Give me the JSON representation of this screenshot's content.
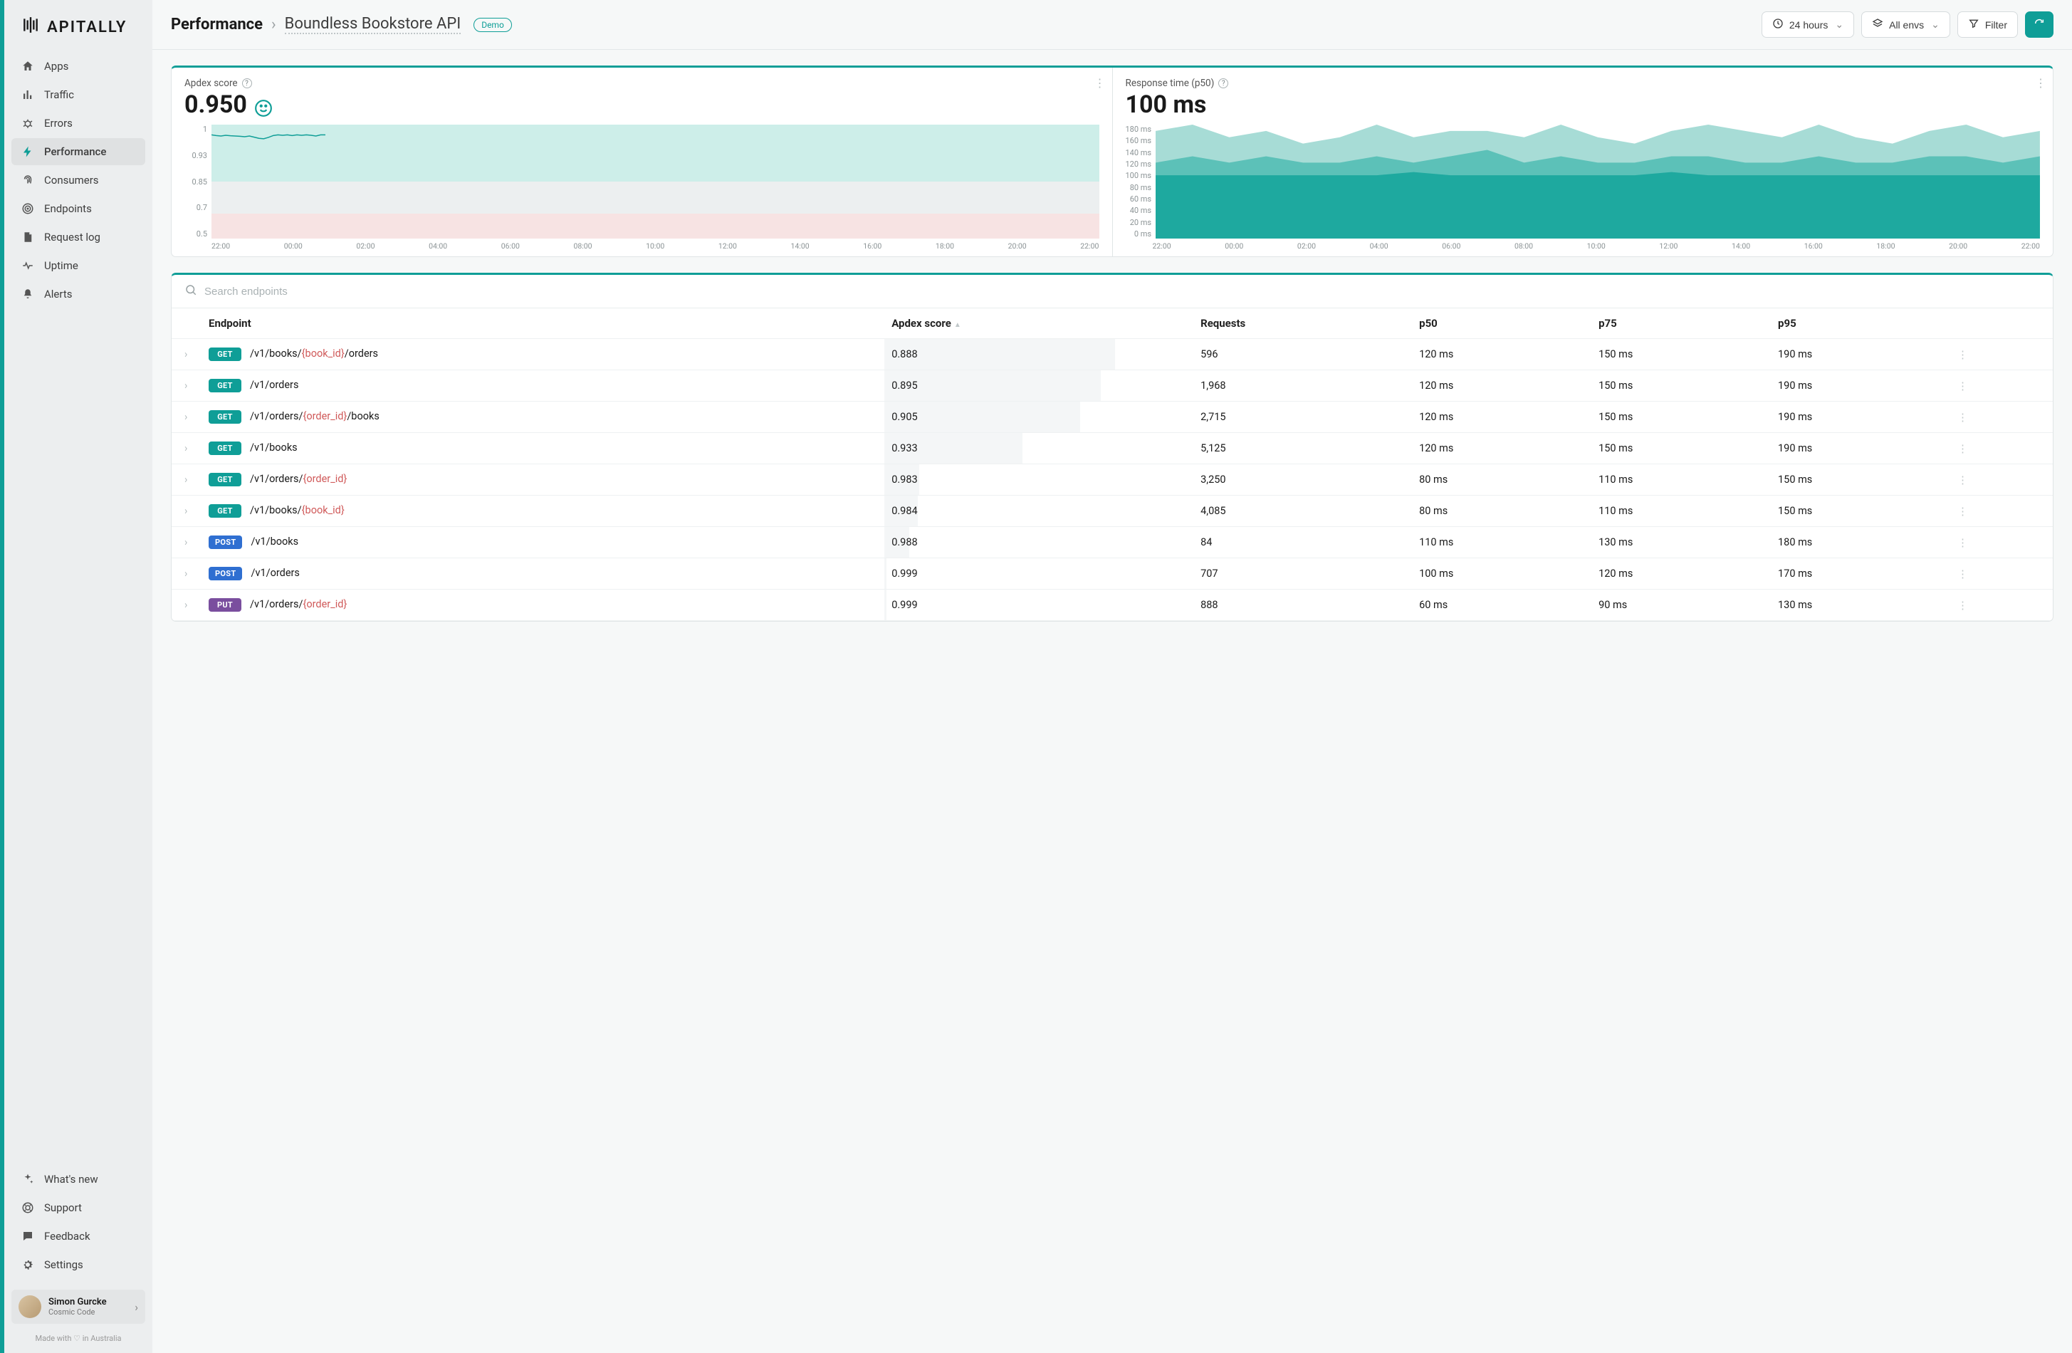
{
  "brand": "APITALLY",
  "sidebar": {
    "items": [
      {
        "label": "Apps",
        "icon": "home"
      },
      {
        "label": "Traffic",
        "icon": "bar"
      },
      {
        "label": "Errors",
        "icon": "bug"
      },
      {
        "label": "Performance",
        "icon": "bolt",
        "active": true
      },
      {
        "label": "Consumers",
        "icon": "fingerprint"
      },
      {
        "label": "Endpoints",
        "icon": "target"
      },
      {
        "label": "Request log",
        "icon": "doc"
      },
      {
        "label": "Uptime",
        "icon": "heart"
      },
      {
        "label": "Alerts",
        "icon": "bell"
      }
    ],
    "bottom": [
      {
        "label": "What's new",
        "icon": "sparkles"
      },
      {
        "label": "Support",
        "icon": "lifebuoy"
      },
      {
        "label": "Feedback",
        "icon": "chat"
      },
      {
        "label": "Settings",
        "icon": "gear"
      }
    ]
  },
  "user": {
    "name": "Simon Gurcke",
    "org": "Cosmic Code"
  },
  "footer": {
    "made": "Made with ♡ in Australia"
  },
  "header": {
    "crumb1": "Performance",
    "crumb2": "Boundless Bookstore API",
    "demo": "Demo",
    "time_range": "24 hours",
    "env": "All envs",
    "filter": "Filter"
  },
  "cards": {
    "apdex": {
      "title": "Apdex score",
      "value": "0.950"
    },
    "resp": {
      "title": "Response time (p50)",
      "value": "100 ms"
    }
  },
  "chart_data": [
    {
      "type": "area",
      "title": "Apdex score",
      "ylabel": "",
      "xlabel": "",
      "ylim": [
        0.5,
        1.0
      ],
      "y_ticks": [
        "1",
        "0.93",
        "0.85",
        "0.7",
        "0.5"
      ],
      "x_ticks": [
        "22:00",
        "00:00",
        "02:00",
        "04:00",
        "06:00",
        "08:00",
        "10:00",
        "12:00",
        "14:00",
        "16:00",
        "18:00",
        "20:00",
        "22:00"
      ],
      "bands": [
        {
          "from": 0.93,
          "to": 1.0,
          "color": "#cdeee9"
        },
        {
          "from": 0.85,
          "to": 0.93,
          "color": "#eceff0"
        },
        {
          "from": 0.5,
          "to": 0.85,
          "color": "#f7e3e3"
        }
      ],
      "series": [
        {
          "name": "apdex",
          "color": "#0f9e97",
          "values": [
            0.955,
            0.952,
            0.95,
            0.953,
            0.951,
            0.95,
            0.949,
            0.947,
            0.95,
            0.945,
            0.94,
            0.938,
            0.944,
            0.952,
            0.955,
            0.953,
            0.955,
            0.952,
            0.955,
            0.953,
            0.955,
            0.953,
            0.95,
            0.955,
            0.955
          ]
        }
      ]
    },
    {
      "type": "area",
      "title": "Response time",
      "ylabel": "ms",
      "xlabel": "",
      "ylim": [
        0,
        180
      ],
      "y_ticks": [
        "180 ms",
        "160 ms",
        "140 ms",
        "120 ms",
        "100 ms",
        "80 ms",
        "60 ms",
        "40 ms",
        "20 ms",
        "0 ms"
      ],
      "x_ticks": [
        "22:00",
        "00:00",
        "02:00",
        "04:00",
        "06:00",
        "08:00",
        "10:00",
        "12:00",
        "14:00",
        "16:00",
        "18:00",
        "20:00",
        "22:00"
      ],
      "series": [
        {
          "name": "p95",
          "color": "#a7dcd6",
          "values": [
            170,
            180,
            160,
            170,
            150,
            160,
            180,
            160,
            170,
            170,
            160,
            180,
            160,
            150,
            170,
            180,
            170,
            160,
            180,
            160,
            150,
            170,
            180,
            160,
            170
          ]
        },
        {
          "name": "p75",
          "color": "#5cc1b8",
          "values": [
            120,
            130,
            120,
            130,
            120,
            120,
            130,
            120,
            130,
            140,
            120,
            130,
            120,
            120,
            130,
            130,
            120,
            120,
            130,
            120,
            120,
            130,
            130,
            120,
            130
          ]
        },
        {
          "name": "p50",
          "color": "#1ea99f",
          "values": [
            100,
            100,
            100,
            100,
            100,
            100,
            100,
            105,
            100,
            100,
            100,
            100,
            100,
            100,
            105,
            100,
            100,
            100,
            100,
            100,
            100,
            100,
            100,
            100,
            100
          ]
        }
      ]
    }
  ],
  "table": {
    "search_placeholder": "Search endpoints",
    "columns": [
      "Endpoint",
      "Apdex score",
      "Requests",
      "p50",
      "p75",
      "p95"
    ],
    "sort_col": 1,
    "rows": [
      {
        "method": "GET",
        "path": [
          [
            "t",
            "/v1/books/"
          ],
          [
            "v",
            "{book_id}"
          ],
          [
            "t",
            "/orders"
          ]
        ],
        "apdex": "0.888",
        "apdex_frac": 0.888,
        "requests": "596",
        "p50": "120 ms",
        "p75": "150 ms",
        "p95": "190 ms"
      },
      {
        "method": "GET",
        "path": [
          [
            "t",
            "/v1/orders"
          ]
        ],
        "apdex": "0.895",
        "apdex_frac": 0.895,
        "requests": "1,968",
        "p50": "120 ms",
        "p75": "150 ms",
        "p95": "190 ms"
      },
      {
        "method": "GET",
        "path": [
          [
            "t",
            "/v1/orders/"
          ],
          [
            "v",
            "{order_id}"
          ],
          [
            "t",
            "/books"
          ]
        ],
        "apdex": "0.905",
        "apdex_frac": 0.905,
        "requests": "2,715",
        "p50": "120 ms",
        "p75": "150 ms",
        "p95": "190 ms"
      },
      {
        "method": "GET",
        "path": [
          [
            "t",
            "/v1/books"
          ]
        ],
        "apdex": "0.933",
        "apdex_frac": 0.933,
        "requests": "5,125",
        "p50": "120 ms",
        "p75": "150 ms",
        "p95": "190 ms"
      },
      {
        "method": "GET",
        "path": [
          [
            "t",
            "/v1/orders/"
          ],
          [
            "v",
            "{order_id}"
          ]
        ],
        "apdex": "0.983",
        "apdex_frac": 0.983,
        "requests": "3,250",
        "p50": "80 ms",
        "p75": "110 ms",
        "p95": "150 ms"
      },
      {
        "method": "GET",
        "path": [
          [
            "t",
            "/v1/books/"
          ],
          [
            "v",
            "{book_id}"
          ]
        ],
        "apdex": "0.984",
        "apdex_frac": 0.984,
        "requests": "4,085",
        "p50": "80 ms",
        "p75": "110 ms",
        "p95": "150 ms"
      },
      {
        "method": "POST",
        "path": [
          [
            "t",
            "/v1/books"
          ]
        ],
        "apdex": "0.988",
        "apdex_frac": 0.988,
        "requests": "84",
        "p50": "110 ms",
        "p75": "130 ms",
        "p95": "180 ms"
      },
      {
        "method": "POST",
        "path": [
          [
            "t",
            "/v1/orders"
          ]
        ],
        "apdex": "0.999",
        "apdex_frac": 0.999,
        "requests": "707",
        "p50": "100 ms",
        "p75": "120 ms",
        "p95": "170 ms"
      },
      {
        "method": "PUT",
        "path": [
          [
            "t",
            "/v1/orders/"
          ],
          [
            "v",
            "{order_id}"
          ]
        ],
        "apdex": "0.999",
        "apdex_frac": 0.999,
        "requests": "888",
        "p50": "60 ms",
        "p75": "90 ms",
        "p95": "130 ms"
      }
    ]
  }
}
